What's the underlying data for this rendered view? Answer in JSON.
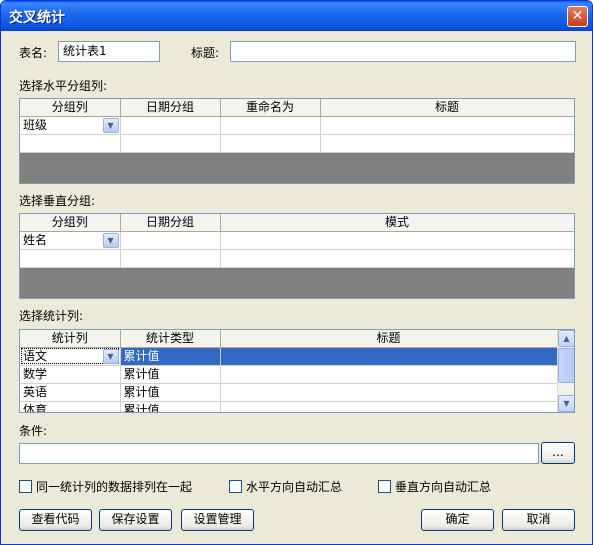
{
  "window": {
    "title": "交叉统计",
    "close_glyph": "✕"
  },
  "table_name": {
    "label": "表名:",
    "value": "统计表1"
  },
  "caption": {
    "label": "标题:",
    "value": ""
  },
  "horizontal": {
    "section_label": "选择水平分组列:",
    "headers": [
      "分组列",
      "日期分组",
      "重命名为",
      "标题"
    ],
    "rows": [
      [
        "班级",
        "",
        "",
        ""
      ],
      [
        "",
        "",
        "",
        ""
      ]
    ]
  },
  "vertical": {
    "section_label": "选择垂直分组:",
    "headers": [
      "分组列",
      "日期分组",
      "模式"
    ],
    "rows": [
      [
        "姓名",
        "",
        ""
      ],
      [
        "",
        "",
        ""
      ]
    ]
  },
  "stats": {
    "section_label": "选择统计列:",
    "headers": [
      "统计列",
      "统计类型",
      "标题"
    ],
    "rows": [
      [
        "语文",
        "累计值",
        ""
      ],
      [
        "数学",
        "累计值",
        ""
      ],
      [
        "英语",
        "累计值",
        ""
      ],
      [
        "体育",
        "累计值",
        ""
      ]
    ]
  },
  "condition": {
    "label": "条件:",
    "value": "",
    "browse_label": "..."
  },
  "options": {
    "group_same": "同一统计列的数据排列在一起",
    "h_auto_sum": "水平方向自动汇总",
    "v_auto_sum": "垂直方向自动汇总"
  },
  "buttons": {
    "view_code": "查看代码",
    "save_settings": "保存设置",
    "settings_manage": "设置管理",
    "ok": "确定",
    "cancel": "取消"
  }
}
